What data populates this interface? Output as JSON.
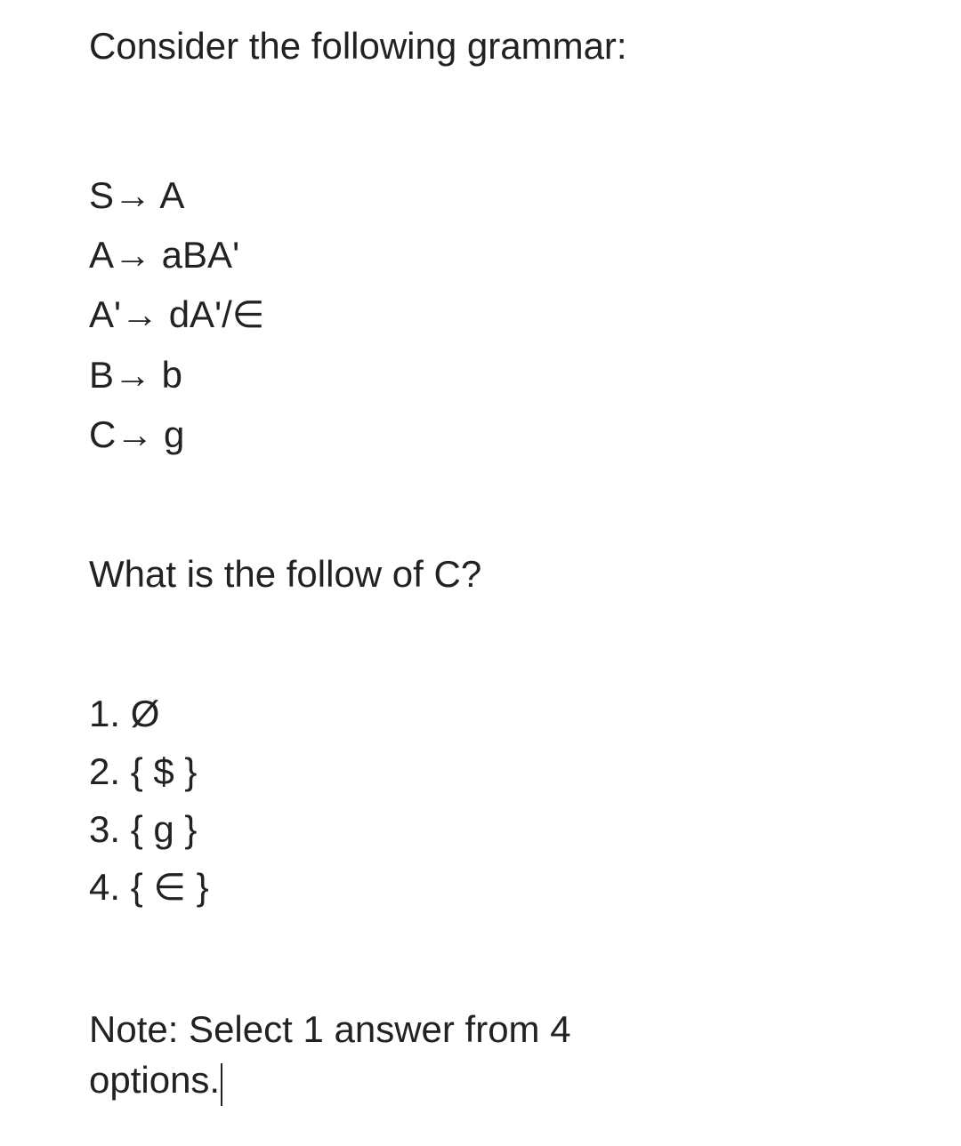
{
  "heading": "Consider the following grammar:",
  "grammar": {
    "lines": [
      "S→ A",
      "A→ aBA'",
      "A'→ dA'/∈",
      "B→ b",
      "C→ g"
    ]
  },
  "question": "What is the follow of C?",
  "options": {
    "lines": [
      "1. Ø",
      "2. { $ }",
      "3. { g }",
      "4. { ∈ }"
    ]
  },
  "note": {
    "line1": "Note: Select 1 answer from 4",
    "line2": "options."
  }
}
